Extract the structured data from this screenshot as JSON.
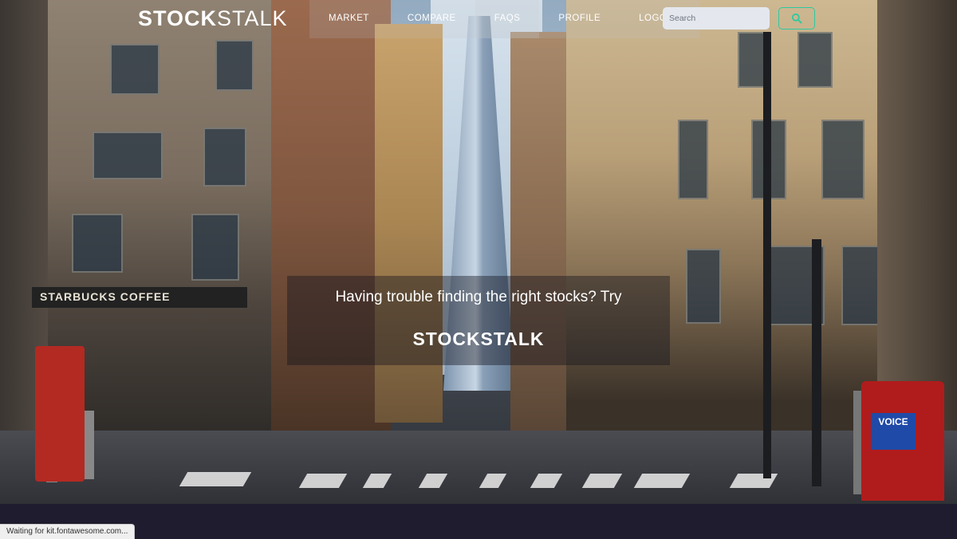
{
  "nav": {
    "brand_bold": "STOCK",
    "brand_light": "STALK",
    "items": [
      {
        "label": "MARKET"
      },
      {
        "label": "COMPARE"
      },
      {
        "label": "FAQS"
      },
      {
        "label": "PROFILE"
      },
      {
        "label": "LOGOUT"
      }
    ],
    "search": {
      "placeholder": "Search",
      "value": ""
    },
    "search_button_icon": "magnifier-icon",
    "accent_color": "#2ec9a0"
  },
  "hero": {
    "tagline": "Having trouble finding the right stocks? Try",
    "brand": "STOCKSTALK",
    "background": "city-street-photo",
    "sign_text": "STARBUCKS COFFEE",
    "mailbox_text": "VOICE"
  },
  "footer": {
    "background_color": "#1e1c2e"
  },
  "status": {
    "text": "Waiting for kit.fontawesome.com..."
  }
}
